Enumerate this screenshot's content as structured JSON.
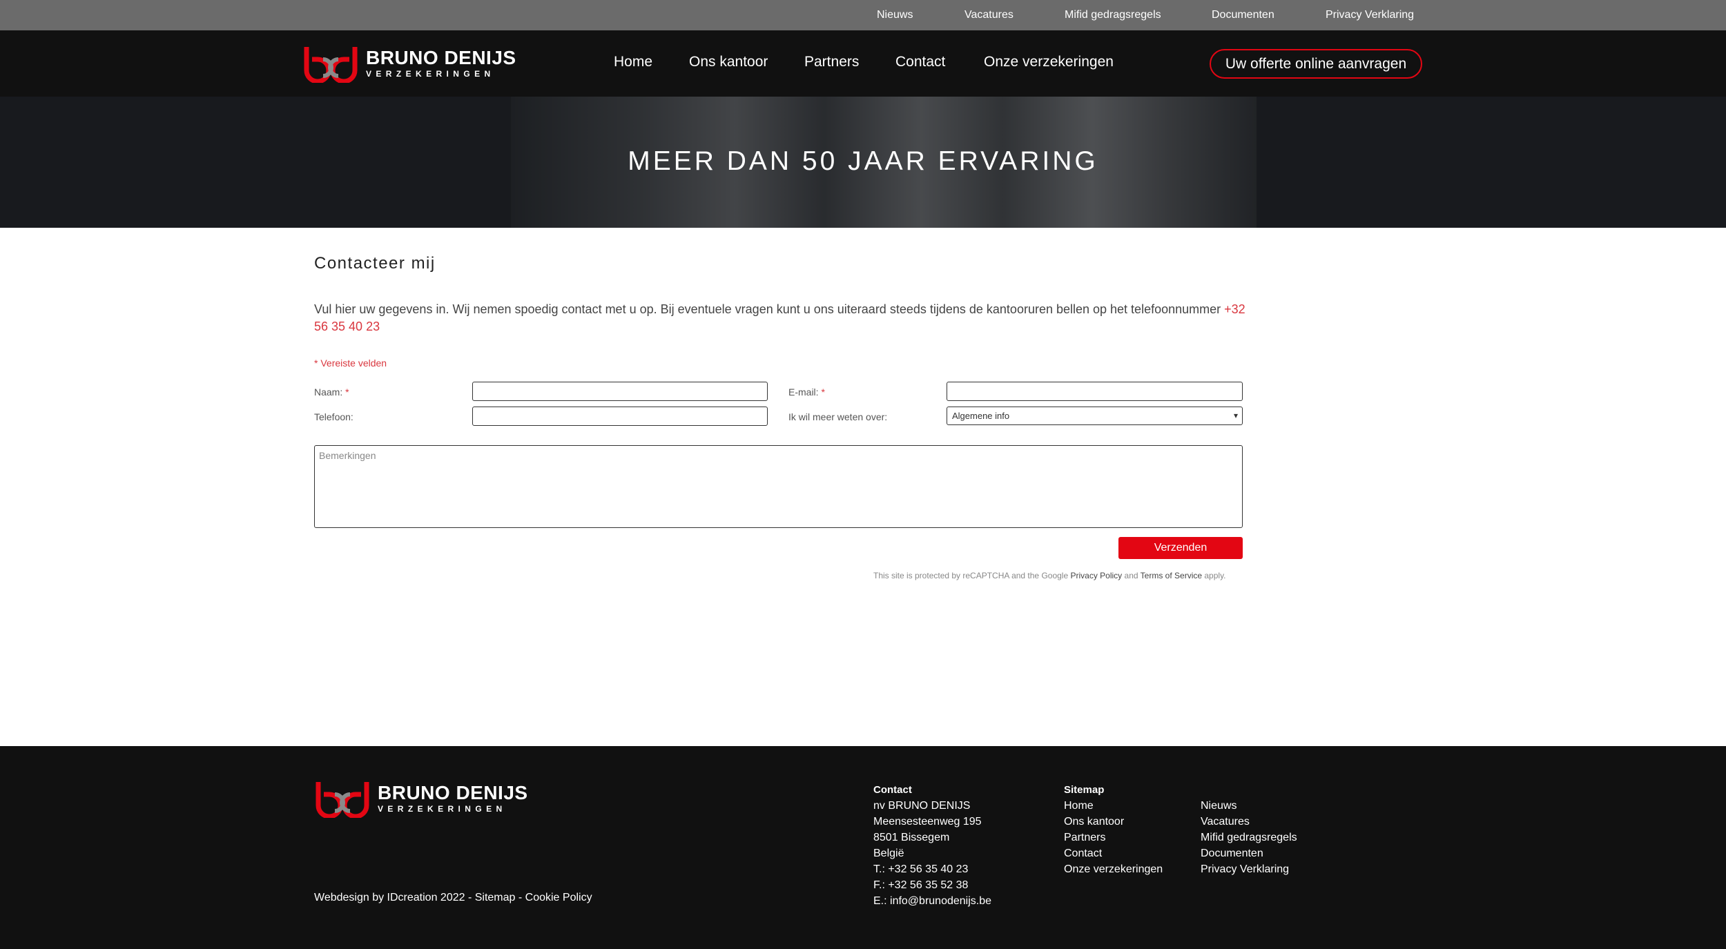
{
  "topbar": {
    "links": [
      "Nieuws",
      "Vacatures",
      "Mifid gedragsregels",
      "Documenten",
      "Privacy Verklaring"
    ]
  },
  "brand": {
    "line1": "BRUNO DENIJS",
    "line2": "VERZEKERINGEN",
    "accent": "#e30613"
  },
  "nav": {
    "links": [
      "Home",
      "Ons kantoor",
      "Partners",
      "Contact",
      "Onze verzekeringen"
    ],
    "cta": "Uw offerte online aanvragen"
  },
  "hero": {
    "title": "MEER DAN 50 JAAR ERVARING"
  },
  "form": {
    "title": "Contacteer mij",
    "intro": "Vul hier uw gegevens in. Wij nemen spoedig contact met u op. Bij eventuele vragen kunt u ons uiteraard steeds tijdens de kantooruren bellen op het telefoonnummer",
    "phone": "+32 56 35 40 23",
    "required_note": "* Vereiste velden",
    "name_label": "Naam:",
    "email_label": "E-mail:",
    "phone_label": "Telefoon:",
    "topic_label": "Ik wil meer weten over:",
    "topic_selected": "Algemene info",
    "required_star": "*",
    "remarks_placeholder": "Bemerkingen",
    "submit": "Verzenden",
    "recaptcha_pre": "This site is protected by reCAPTCHA and the Google",
    "privacy_policy": "Privacy Policy",
    "and": "and",
    "terms": "Terms of Service",
    "apply": "apply."
  },
  "footer": {
    "contact_heading": "Contact",
    "contact_lines": [
      "nv BRUNO DENIJS",
      "Meensesteenweg 195",
      "8501 Bissegem",
      "België",
      "T.: +32 56 35 40 23",
      "F.: +32 56 35 52 38",
      "E.: info@brunodenijs.be"
    ],
    "sitemap_heading": "Sitemap",
    "sitemap_col1": [
      "Home",
      "Ons kantoor",
      "Partners",
      "Contact",
      "Onze verzekeringen"
    ],
    "sitemap_col2": [
      "Nieuws",
      "Vacatures",
      "Mifid gedragsregels",
      "Documenten",
      "Privacy Verklaring"
    ],
    "credits": "Webdesign by IDcreation 2022 - Sitemap - Cookie Policy"
  }
}
